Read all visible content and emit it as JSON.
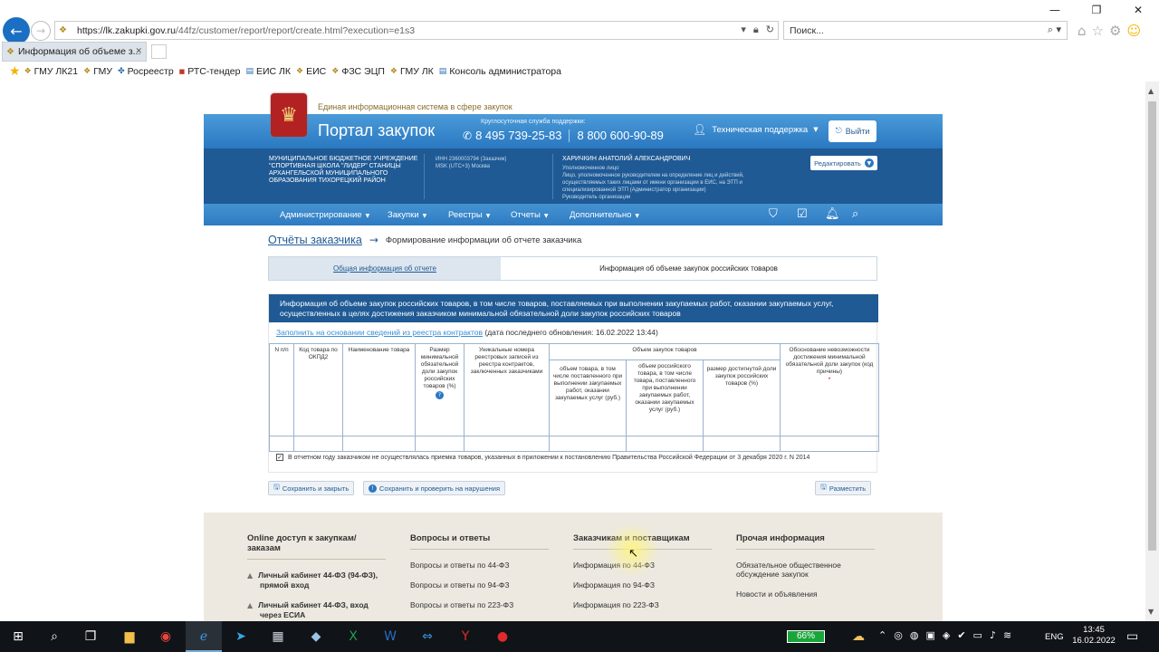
{
  "browser": {
    "url_host": "https://lk.zakupki.gov.ru",
    "url_path": "/44fz/customer/report/report/create.html?execution=e1s3",
    "search_placeholder": "Поиск...",
    "tab_title": "Информация об объеме з...",
    "favorites": [
      "ГМУ ЛК21",
      "ГМУ",
      "Росреестр",
      "РТС-тендер",
      "ЕИС ЛК",
      "ЕИС",
      "ФЗС ЭЦП",
      "ГМУ ЛК",
      "Консоль администратора"
    ]
  },
  "site": {
    "eis_title": "Единая информационная система в сфере закупок",
    "portal_title": "Портал закупок",
    "support_label": "Круглосуточная служба поддержки:",
    "phone1": "8 495 739-25-83",
    "phone2": "8 800 600-90-89",
    "tech_support": "Техническая поддержка",
    "exit": "Выйти",
    "org_name": "МУНИЦИПАЛЬНОЕ БЮДЖЕТНОЕ УЧРЕЖДЕНИЕ \"СПОРТИВНАЯ ШКОЛА \"ЛИДЕР\" СТАНИЦЫ АРХАНГЕЛЬСКОЙ МУНИЦИПАЛЬНОГО ОБРАЗОВАНИЯ ТИХОРЕЦКИЙ РАЙОН",
    "org_inn": "ИНН 2360003794 (Заказчик)",
    "org_tz": "MSK (UTC+3) Москва",
    "user_name": "ХАРИЧКИН АНАТОЛИЙ АЛЕКСАНДРОВИЧ",
    "user_role": "Уполномоченное лицо\nЛицо, уполномоченное руководителем на определение лиц и действий, осуществляемых таких лицами от имени организации в ЕИС, на ЭТП и специализированной ЭТП (Администратор организации)\nРуководитель организации",
    "edit": "Редактировать",
    "menu": [
      "Администрирование",
      "Закупки",
      "Реестры",
      "Отчеты",
      "Дополнительно"
    ]
  },
  "page": {
    "crumb_link": "Отчёты заказчика",
    "crumb_current": "Формирование информации об отчете заказчика",
    "tab_general": "Общая информация об отчете",
    "tab_info": "Информация об объеме закупок российских товаров",
    "form_heading": "Информация об объеме закупок российских товаров, в том числе товаров, поставляемых при выполнении закупаемых работ, оказании закупаемых услуг, осуществленных в целях достижения заказчиком минимальной обязательной доли закупок российских товаров",
    "fill_link": "Заполнить на основании сведений из реестра контрактов",
    "fill_date": "(дата последнего обновления: 16.02.2022 13:44)",
    "columns": {
      "num": "N п/п",
      "okpd": "Код товара по ОКПД2",
      "name": "Наименование товара",
      "min_share": "Размер минимальной обязательной доли закупок российских товаров (%)",
      "registry": "Уникальные номера реестровых записей из реестра контрактов, заключенных заказчиками",
      "volume_group": "Объем закупок товаров",
      "volume_total": "объем товара, в том числе поставленного при выполнении закупаемых работ, оказании закупаемых услуг (руб.)",
      "volume_russian": "объем российского товара, в том числе товара, поставленного при выполнении закупаемых работ, оказании закупаемых услуг (руб.)",
      "share_achieved": "размер достигнутой доли закупок российских товаров (%)",
      "justification": "Обоснование невозможности достижения минимальной обязательной доли закупок (код причины)"
    },
    "checkbox_label": "В отчетном году заказчиком не осуществлялась приемка товаров, указанных в приложении к постановлению Правительства Российской Федерации от 3 декабря 2020 г. N 2014",
    "checkbox_checked": true,
    "btn_save_close": "Сохранить и закрыть",
    "btn_save_check": "Сохранить и проверить на нарушения",
    "btn_publish": "Разместить"
  },
  "footer": {
    "col1_title": "Online доступ к закупкам/заказам",
    "col1_items": [
      "Личный кабинет 44-ФЗ (94-ФЗ), прямой вход",
      "Личный кабинет 44-ФЗ, вход через ЕСИА"
    ],
    "col2_title": "Вопросы и ответы",
    "col2_items": [
      "Вопросы и ответы по 44-ФЗ",
      "Вопросы и ответы по 94-ФЗ",
      "Вопросы и ответы по 223-ФЗ"
    ],
    "col3_title": "Заказчикам и поставщикам",
    "col3_items": [
      "Информация по 44-ФЗ",
      "Информация по 94-ФЗ",
      "Информация по 223-ФЗ"
    ],
    "col4_title": "Прочая информация",
    "col4_items": [
      "Обязательное общественное обсуждение закупок",
      "Новости и объявления"
    ]
  },
  "taskbar": {
    "battery": "66%",
    "lang": "ENG",
    "time": "13:45",
    "date": "16.02.2022"
  }
}
